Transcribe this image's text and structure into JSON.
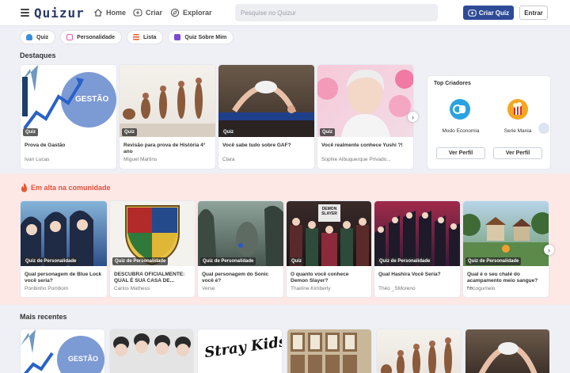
{
  "header": {
    "logo": "Quizur",
    "nav": [
      {
        "label": "Home",
        "icon": "home-icon"
      },
      {
        "label": "Criar",
        "icon": "create-icon"
      },
      {
        "label": "Explorar",
        "icon": "compass-icon"
      }
    ],
    "search_placeholder": "Pesquise no Quizur",
    "create_button": "Criar Quiz",
    "login_button": "Entrar"
  },
  "categories": [
    {
      "label": "Quiz",
      "color": "#3b8fd9"
    },
    {
      "label": "Personalidade",
      "color": "#e05db5"
    },
    {
      "label": "Lista",
      "color": "#e8542e"
    },
    {
      "label": "Quiz Sobre Mim",
      "color": "#7a4bd1"
    }
  ],
  "highlights": {
    "title": "Destaques",
    "cards": [
      {
        "tag": "Quiz",
        "title": "Prova de Gastão",
        "author": "Ivan Lucas",
        "image_text": "GESTÃO"
      },
      {
        "tag": "Quiz",
        "title": "Revisão para prova de História 4° ano",
        "author": "Miguel Martins"
      },
      {
        "tag": "Quiz",
        "title": "Você sabe tudo sobre GAF?",
        "author": "Clara"
      },
      {
        "tag": "Quiz",
        "title": "Você realmente conhece Yushi ?!",
        "author": "Sophie Albuquerque Privado..."
      }
    ]
  },
  "top_creators": {
    "title": "Top Criadores",
    "creators": [
      {
        "name": "Modo Economia",
        "button": "Ver Perfil",
        "color": "#2aa3e0"
      },
      {
        "name": "Serie Mania",
        "button": "Ver Perfil",
        "color": "#f5a623"
      }
    ]
  },
  "trending": {
    "title": "Em alta na comunidade",
    "cards": [
      {
        "tag": "Quiz de Personalidade",
        "title": "Qual personagem de Blue Lock você seria?",
        "author": "Ponbinho Pombom"
      },
      {
        "tag": "Quiz de Personalidade",
        "title": "DESCUBRA OFICIALMENTE: QUAL É SUA CASA DE...",
        "author": "Carlos Matheus"
      },
      {
        "tag": "Quiz de Personalidade",
        "title": "Qual personagem do Sonic você é?",
        "author": "Verse"
      },
      {
        "tag": "Quiz",
        "title": "O quanto você conhece Demon Slayer?",
        "author": "Thairine Kimberly",
        "image_text": "DEMON SLAYER"
      },
      {
        "tag": "Quiz de Personalidade",
        "title": "Qual Hashira Você Seria?",
        "author": "Théo _SMoreno"
      },
      {
        "tag": "Quiz de Personalidade",
        "title": "Qual é o seu chalé do acampamento meio sangue? -...",
        "author": "nbcogumelo"
      }
    ]
  },
  "recent": {
    "title": "Mais recentes",
    "image_texts": [
      "GESTÃO",
      "Stray Kids"
    ]
  }
}
